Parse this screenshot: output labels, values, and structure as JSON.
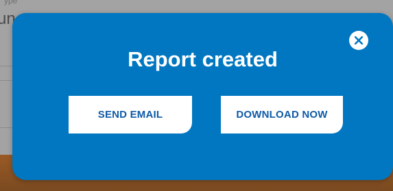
{
  "background": {
    "field_label": "ype",
    "field_value": "un"
  },
  "modal": {
    "title": "Report created",
    "send_email_label": "SEND EMAIL",
    "download_label": "DOWNLOAD NOW",
    "close_icon": "close-icon"
  },
  "colors": {
    "modal_bg": "#0077c0",
    "button_text": "#0d5aa7",
    "overlay": "#a3a3a3"
  }
}
